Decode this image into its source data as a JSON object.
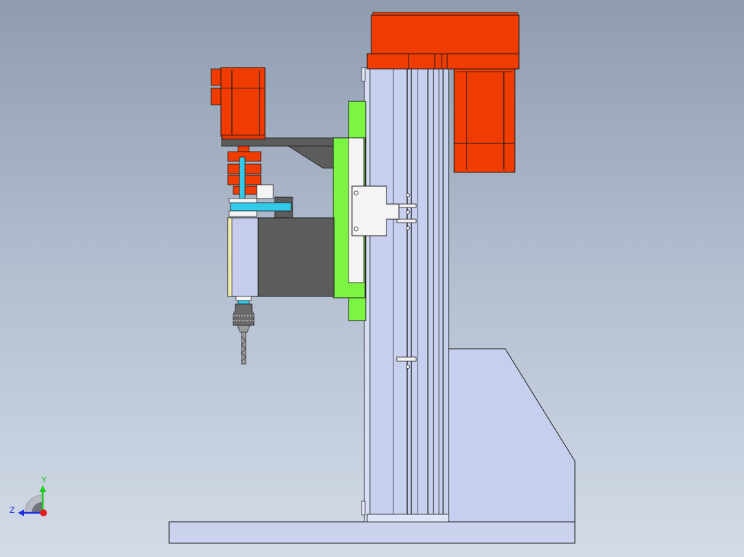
{
  "window": {
    "title": ""
  },
  "colors": {
    "background_top": "#8f9cb0",
    "background_bottom": "#d3dbe7",
    "motor_red": "#f03c00",
    "column_blue": "#c8d0ef",
    "carriage_green": "#7cf542",
    "housing_gray": "#5c5c5c",
    "belt_cyan": "#33c9e8",
    "outline": "#1a1a1a"
  },
  "model": {
    "parts": [
      "base-plate",
      "column",
      "gusset",
      "top-motor",
      "carriage-plate",
      "spindle-head",
      "spindle-motor",
      "drill-chuck",
      "drill-bit",
      "belt-drive"
    ]
  },
  "triad": {
    "y_label": "Y",
    "z_label": "Z",
    "icons": [
      "y-axis-arrow-icon",
      "z-axis-arrow-icon",
      "x-axis-origin-icon"
    ]
  }
}
